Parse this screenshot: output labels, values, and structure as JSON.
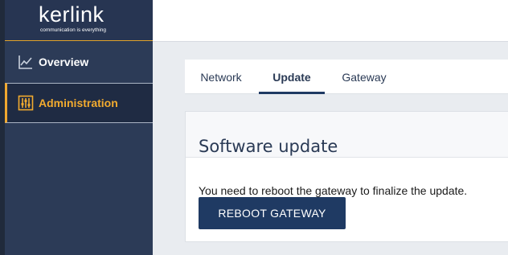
{
  "brand": {
    "logo_text": "kerlink",
    "tagline": "communication is everything"
  },
  "sidebar": {
    "items": [
      {
        "label": "Overview",
        "icon": "line-chart-icon",
        "active": false
      },
      {
        "label": "Administration",
        "icon": "sliders-icon",
        "active": true
      }
    ]
  },
  "tabs": [
    {
      "label": "Network",
      "active": false
    },
    {
      "label": "Update",
      "active": true
    },
    {
      "label": "Gateway",
      "active": false
    }
  ],
  "card": {
    "title": "Software update",
    "message": "You need to reboot the gateway to finalize the update.",
    "button_label": "REBOOT GATEWAY"
  },
  "colors": {
    "sidebar_bg": "#2c3b57",
    "active_accent": "#f2ab2f",
    "button_bg": "#1f3a63",
    "page_bg": "#e9ecf0"
  }
}
